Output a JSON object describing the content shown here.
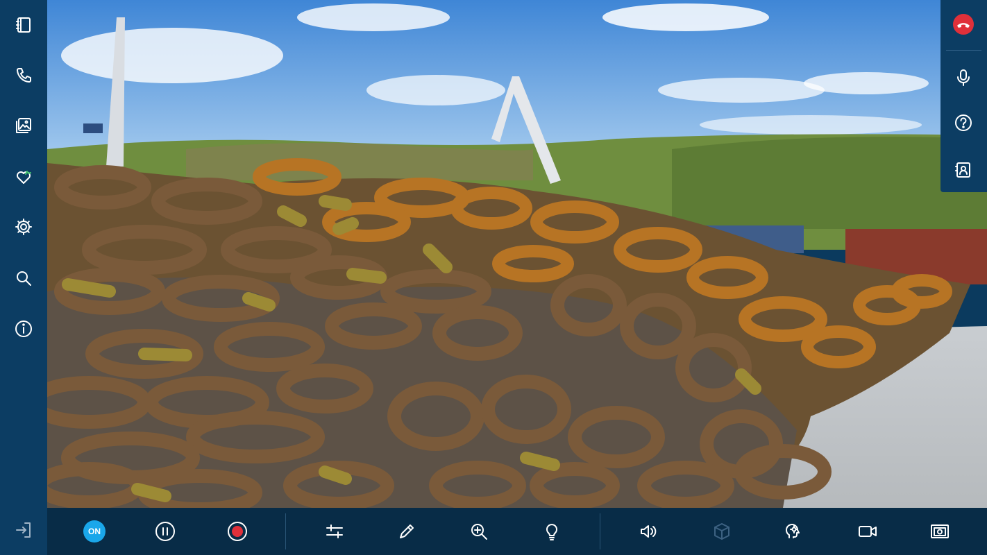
{
  "status": {
    "on_label": "ON"
  },
  "icons": {
    "left_sidebar": [
      "notebook-icon",
      "phone-icon",
      "gallery-icon",
      "health-heart-icon",
      "settings-gear-icon",
      "search-icon",
      "info-icon"
    ],
    "logout": "logout-icon",
    "right_panel": [
      "end-call-icon",
      "microphone-icon",
      "help-icon",
      "contact-card-icon"
    ],
    "toolbar": [
      "on-toggle",
      "pause-icon",
      "record-icon",
      "adjust-sliders-icon",
      "pencil-icon",
      "zoom-in-icon",
      "lightbulb-icon",
      "volume-icon",
      "3d-box-icon",
      "ai-assist-icon",
      "video-camera-icon",
      "snapshot-icon"
    ]
  },
  "colors": {
    "sidebar": "#0c3d63",
    "toolbar": "#082c47",
    "accent_on": "#1aa7ea",
    "end_call": "#e0303a",
    "record": "#e0303a",
    "disabled_icon": "#3d6282"
  }
}
